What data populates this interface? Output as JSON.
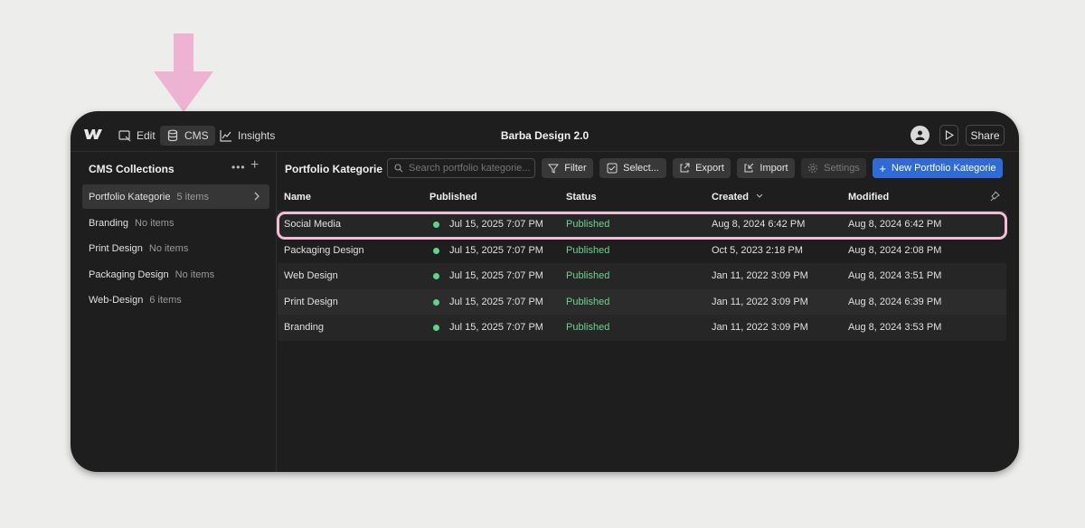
{
  "topbar": {
    "modes": [
      {
        "label": "Edit",
        "icon": "edit-icon"
      },
      {
        "label": "CMS",
        "icon": "database-icon"
      },
      {
        "label": "Insights",
        "icon": "chart-line-icon"
      }
    ],
    "site_title": "Barba Design 2.0",
    "share_label": "Share"
  },
  "sidebar": {
    "title": "CMS Collections",
    "collections": [
      {
        "name": "Portfolio Kategorie",
        "count": "5 items"
      },
      {
        "name": "Branding",
        "count": "No items"
      },
      {
        "name": "Print Design",
        "count": "No items"
      },
      {
        "name": "Packaging Design",
        "count": "No items"
      },
      {
        "name": "Web-Design",
        "count": "6 items"
      }
    ]
  },
  "main": {
    "title": "Portfolio Kategorie",
    "search_placeholder": "Search portfolio kategorie...",
    "toolbar": {
      "filter": "Filter",
      "select": "Select...",
      "export": "Export",
      "import": "Import",
      "settings": "Settings",
      "new_item": "New Portfolio Kategorie"
    },
    "columns": [
      "Name",
      "Published",
      "Status",
      "Created",
      "Modified"
    ],
    "rows": [
      {
        "name": "Social Media",
        "published": "Jul 15, 2025 7:07 PM",
        "status": "Published",
        "created": "Aug 8, 2024 6:42 PM",
        "modified": "Aug 8, 2024 6:42 PM"
      },
      {
        "name": "Packaging Design",
        "published": "Jul 15, 2025 7:07 PM",
        "status": "Published",
        "created": "Oct 5, 2023 2:18 PM",
        "modified": "Aug 8, 2024 2:08 PM"
      },
      {
        "name": "Web Design",
        "published": "Jul 15, 2025 7:07 PM",
        "status": "Published",
        "created": "Jan 11, 2022 3:09 PM",
        "modified": "Aug 8, 2024 3:51 PM"
      },
      {
        "name": "Print Design",
        "published": "Jul 15, 2025 7:07 PM",
        "status": "Published",
        "created": "Jan 11, 2022 3:09 PM",
        "modified": "Aug 8, 2024 6:39 PM"
      },
      {
        "name": "Branding",
        "published": "Jul 15, 2025 7:07 PM",
        "status": "Published",
        "created": "Jan 11, 2022 3:09 PM",
        "modified": "Aug 8, 2024 3:53 PM"
      }
    ]
  },
  "colors": {
    "highlight": "#f1bcd7",
    "arrow": "#eeb3d2",
    "published_dot": "#5ed48a",
    "primary_button": "#2f6bd8"
  }
}
